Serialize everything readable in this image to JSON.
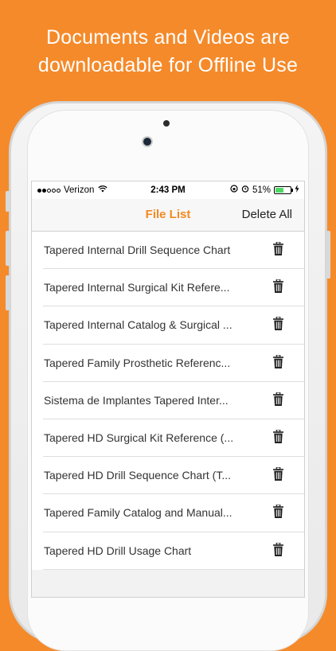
{
  "headline": {
    "line1": "Documents and Videos are",
    "line2": "downloadable for Offline Use"
  },
  "status_bar": {
    "carrier": "Verizon",
    "time": "2:43 PM",
    "battery": "51%",
    "battery_level": 0.51
  },
  "navbar": {
    "title": "File List",
    "delete_all": "Delete All"
  },
  "files": [
    "Tapered Internal Drill Sequence Chart",
    "Tapered Internal Surgical Kit Refere...",
    "Tapered Internal Catalog & Surgical ...",
    "Tapered Family Prosthetic Referenc...",
    "Sistema de Implantes Tapered Inter...",
    "Tapered HD Surgical Kit Reference (...",
    "Tapered HD Drill Sequence Chart (T...",
    "Tapered Family Catalog and Manual...",
    "Tapered HD Drill Usage Chart"
  ],
  "colors": {
    "background": "#f58a2a",
    "accent": "#f5891f"
  }
}
